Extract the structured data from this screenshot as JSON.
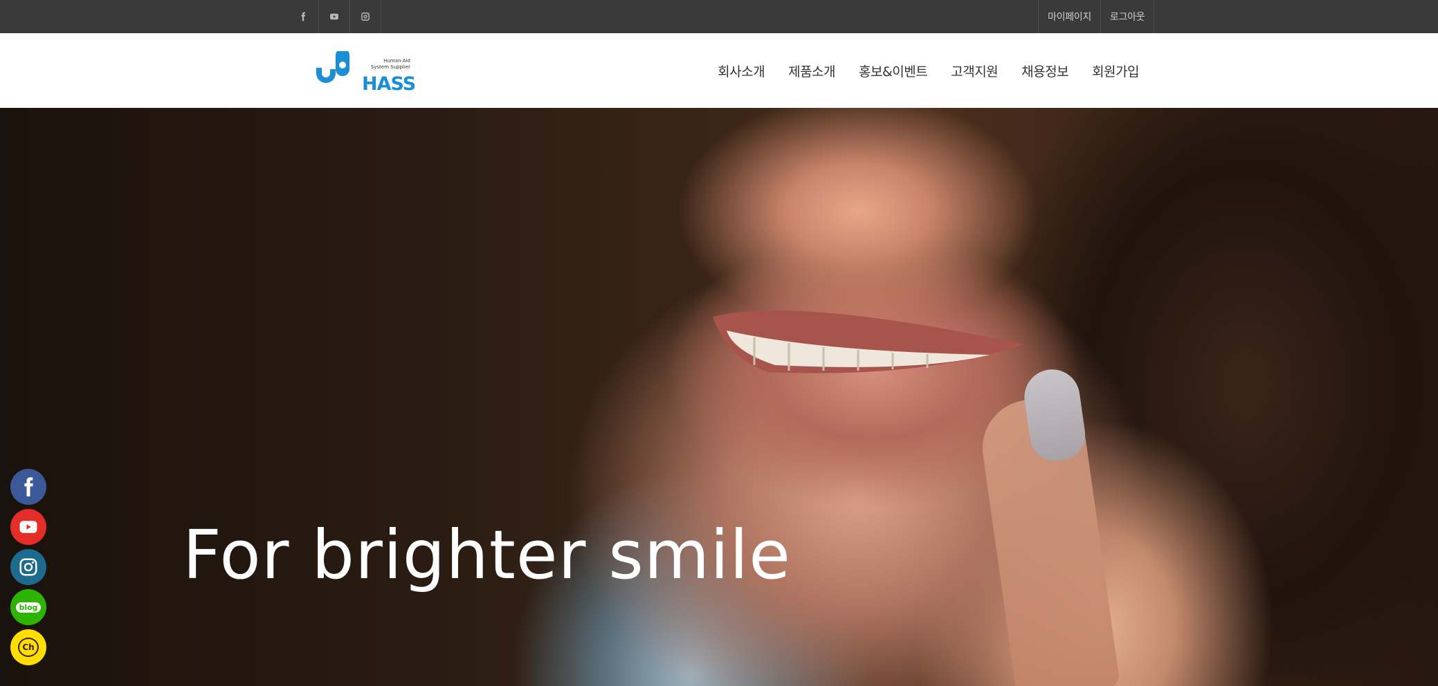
{
  "topbar": {
    "social": [
      {
        "icon": "facebook-icon"
      },
      {
        "icon": "youtube-icon"
      },
      {
        "icon": "instagram-icon"
      }
    ],
    "links": {
      "mypage": "마이페이지",
      "logout": "로그아웃"
    }
  },
  "header": {
    "logo": {
      "brand": "HASS",
      "tagline_line1": "Human-Aid",
      "tagline_line2": "System Supplier",
      "color": "#1a8fd6"
    },
    "nav": [
      {
        "label": "회사소개"
      },
      {
        "label": "제품소개"
      },
      {
        "label": "홍보&이벤트"
      },
      {
        "label": "고객지원"
      },
      {
        "label": "채용정보"
      },
      {
        "label": "회원가입"
      }
    ]
  },
  "hero": {
    "title": "For brighter smile"
  },
  "side_social": [
    {
      "icon": "facebook-icon",
      "color": "#3b5998"
    },
    {
      "icon": "youtube-icon",
      "color": "#e52d27"
    },
    {
      "icon": "instagram-icon",
      "color": "#1c6a8e"
    },
    {
      "icon": "blog-icon",
      "label": "blog",
      "color": "#2db400"
    },
    {
      "icon": "kakao-channel-icon",
      "label": "Ch",
      "color": "#ffde00"
    }
  ]
}
